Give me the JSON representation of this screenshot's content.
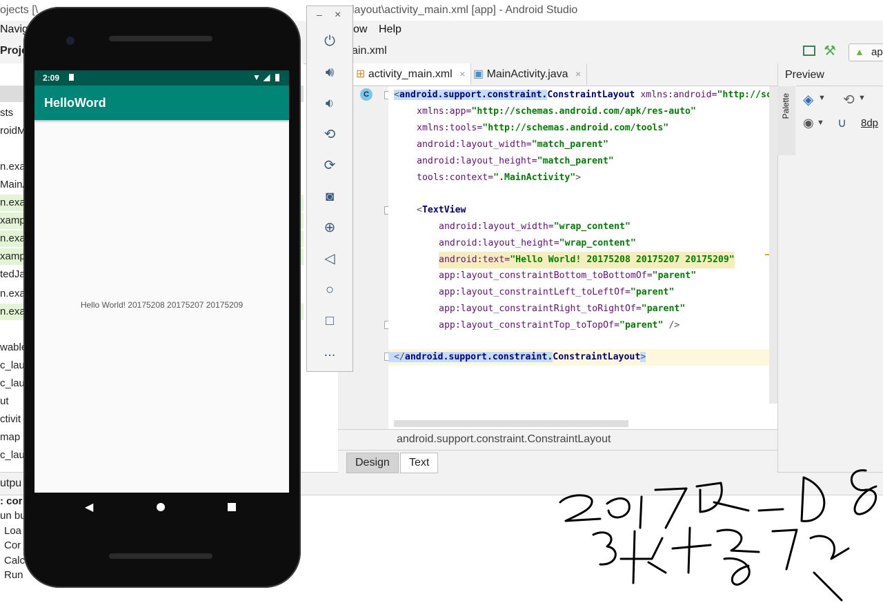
{
  "window": {
    "title_left": "ojects [\\",
    "title_right": "layout\\activity_main.xml [app] - Android Studio"
  },
  "menu": {
    "navigate": "Navig",
    "window": "ow",
    "help": "Help"
  },
  "nav": {
    "project_label": "Proje",
    "file_crumb": "ain.xml",
    "run_config": "ap"
  },
  "project_tree": [
    "sts",
    "roidM",
    "",
    "n.exa",
    "MainA",
    "n.exa",
    "xamp",
    "n.exa",
    "xamp",
    "tedJa",
    "n.exa",
    "n.exa",
    "",
    "wable",
    "c_lau",
    "c_lau",
    "ut",
    "ctivit",
    "map",
    "c_lau"
  ],
  "output": {
    "header": "utpu",
    "lines": [
      ": cor",
      "un bu",
      "Loa",
      "Cor",
      "Calc",
      "Run"
    ]
  },
  "editor": {
    "tabs": [
      {
        "label": "activity_main.xml",
        "close": "×"
      },
      {
        "label": "MainActivity.java",
        "close": "×"
      }
    ],
    "gutter_badge": "C",
    "breadcrumb": "android.support.constraint.ConstraintLayout",
    "bottom_tabs": [
      "Design",
      "Text"
    ]
  },
  "code": {
    "l1_open": "<",
    "l1_tag_pkg": "android.support.constraint.",
    "l1_tag_cls": "ConstraintLayout",
    "l1_attr": " xmlns:android=",
    "l1_val": "\"http://sch",
    "l2_attr": "xmlns:app=",
    "l2_val": "\"http://schemas.android.com/apk/res-auto\"",
    "l3_attr": "xmlns:tools=",
    "l3_val": "\"http://schemas.android.com/tools\"",
    "l4_attr": "android:layout_width=",
    "l4_val": "\"match_parent\"",
    "l5_attr": "android:layout_height=",
    "l5_val": "\"match_parent\"",
    "l6_attr": "tools:context=",
    "l6_val": "\".MainActivity\"",
    "l6_end": ">",
    "l8_open": "<",
    "l8_tag": "TextView",
    "l9_attr": "android:layout_width=",
    "l9_val": "\"wrap_content\"",
    "l10_attr": "android:layout_height=",
    "l10_val": "\"wrap_content\"",
    "l11_attr": "android:text=",
    "l11_val": "\"Hello World! 20175208 20175207 20175209\"",
    "l12_attr": "app:layout_constraintBottom_toBottomOf=",
    "l12_val": "\"parent\"",
    "l13_attr": "app:layout_constraintLeft_toLeftOf=",
    "l13_val": "\"parent\"",
    "l14_attr": "app:layout_constraintRight_toRightOf=",
    "l14_val": "\"parent\"",
    "l15_attr": "app:layout_constraintTop_toTopOf=",
    "l15_val": "\"parent\"",
    "l15_end": " />",
    "l17_open": "</",
    "l17_tag_pkg": "android.support.constraint.",
    "l17_tag_cls": "ConstraintLayout",
    "l17_end": ">"
  },
  "preview": {
    "title": "Preview",
    "palette": "Palette",
    "margin": "8dp"
  },
  "emulator": {
    "toolbar": [
      "minimize",
      "close",
      "power",
      "volume-up",
      "volume-down",
      "rotate-left",
      "rotate-right",
      "screenshot",
      "zoom",
      "back",
      "home",
      "overview",
      "more"
    ],
    "minimize_label": "–",
    "close_label": "×",
    "more_label": "...",
    "status_time": "2:09",
    "app_title": "HelloWord",
    "hello_text": "Hello World! 20175208 20175207 20175209"
  },
  "colors": {
    "status_bar": "#00574b",
    "app_bar": "#008577",
    "selection": "#c4ddff",
    "highlight_line": "#fdf7dc"
  }
}
